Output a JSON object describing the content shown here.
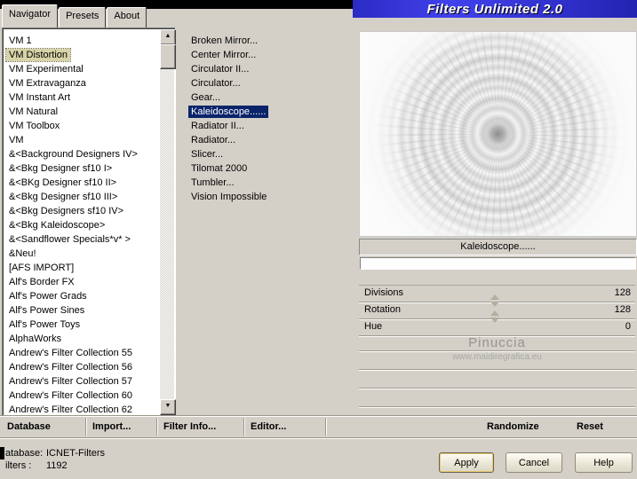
{
  "title_bar": {
    "app_title": "Filters Unlimited 2.0"
  },
  "tabs": [
    {
      "label": "Navigator",
      "active": true
    },
    {
      "label": "Presets",
      "active": false
    },
    {
      "label": "About",
      "active": false
    }
  ],
  "categories": {
    "selected": "VM Distortion",
    "items": [
      "VM 1",
      "VM Distortion",
      "VM Experimental",
      "VM Extravaganza",
      "VM Instant Art",
      "VM Natural",
      "VM Toolbox",
      "VM",
      "&<Background Designers IV>",
      "&<Bkg Designer sf10 I>",
      "&<BKg Designer sf10 II>",
      "&<Bkg Designer sf10 III>",
      "&<Bkg Designers sf10 IV>",
      "&<Bkg Kaleidoscope>",
      "&<Sandflower Specials*v* >",
      "&Neu!",
      "[AFS IMPORT]",
      "Alf's Border FX",
      "Alf's Power Grads",
      "Alf's Power Sines",
      "Alf's Power Toys",
      "AlphaWorks",
      "Andrew's Filter Collection 55",
      "Andrew's Filter Collection 56",
      "Andrew's Filter Collection 57",
      "Andrew's Filter Collection 60",
      "Andrew's Filter Collection 62"
    ]
  },
  "filters": {
    "selected": "Kaleidoscope......",
    "items": [
      "Broken Mirror...",
      "Center Mirror...",
      "Circulator II...",
      "Circulator...",
      "Gear...",
      "Kaleidoscope......",
      "Radiator II...",
      "Radiator...",
      "Slicer...",
      "Tilomat 2000",
      "Tumbler...",
      "Vision Impossible"
    ]
  },
  "preview": {
    "selected_filter_label": "Kaleidoscope......"
  },
  "parameters": [
    {
      "name": "Divisions",
      "value": "128"
    },
    {
      "name": "Rotation",
      "value": "128"
    },
    {
      "name": "Hue",
      "value": "0"
    }
  ],
  "watermark": {
    "line1": "Pinuccia",
    "line2": "www.maidiregrafica.eu"
  },
  "toolbar": {
    "database": "Database",
    "import": "Import...",
    "filter_info": "Filter Info...",
    "editor": "Editor...",
    "randomize": "Randomize",
    "reset": "Reset"
  },
  "status": {
    "database_label": "atabase:",
    "database_value": "ICNET-Filters",
    "filters_label": "ilters :",
    "filters_value": "1192"
  },
  "action_buttons": {
    "apply": "Apply",
    "cancel": "Cancel",
    "help": "Help"
  },
  "icons": {
    "scroll_up": "▲",
    "scroll_down": "▼"
  },
  "colors": {
    "selection_blue": "#0a246a",
    "category_highlight": "#d7d3a8",
    "banner_blue": "#2b2bc4",
    "dialog_gray": "#d4d0c8"
  }
}
